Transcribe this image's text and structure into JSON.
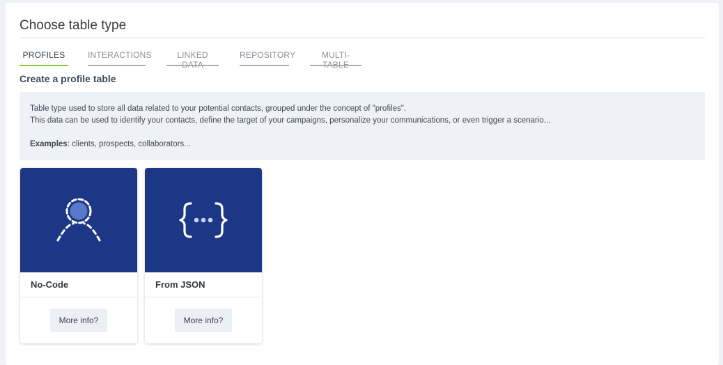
{
  "page": {
    "title": "Choose table type"
  },
  "tabs": [
    {
      "label": "PROFILES",
      "active": true
    },
    {
      "label": "INTERACTIONS",
      "active": false
    },
    {
      "label": "LINKED DATA",
      "active": false
    },
    {
      "label": "REPOSITORY",
      "active": false
    },
    {
      "label": "MULTI-TABLE",
      "active": false
    }
  ],
  "section": {
    "title": "Create a profile table",
    "description_line1": "Table type used to store all data related to your potential contacts, grouped under the concept of \"profiles\".",
    "description_line2": "This data can be used to identify your contacts, define the target of your campaigns, personalize your communications, or even trigger a scenario...",
    "examples_label": "Examples",
    "examples_text": ": clients, prospects, collaborators..."
  },
  "cards": [
    {
      "name": "No-Code",
      "icon": "user-dashed-icon",
      "button": "More info?"
    },
    {
      "name": "From JSON",
      "icon": "json-braces-icon",
      "button": "More info?"
    }
  ],
  "colors": {
    "card_hero": "#1c3785",
    "tab_active_underline": "#8cc63e",
    "info_box_bg": "#eef1f6"
  }
}
